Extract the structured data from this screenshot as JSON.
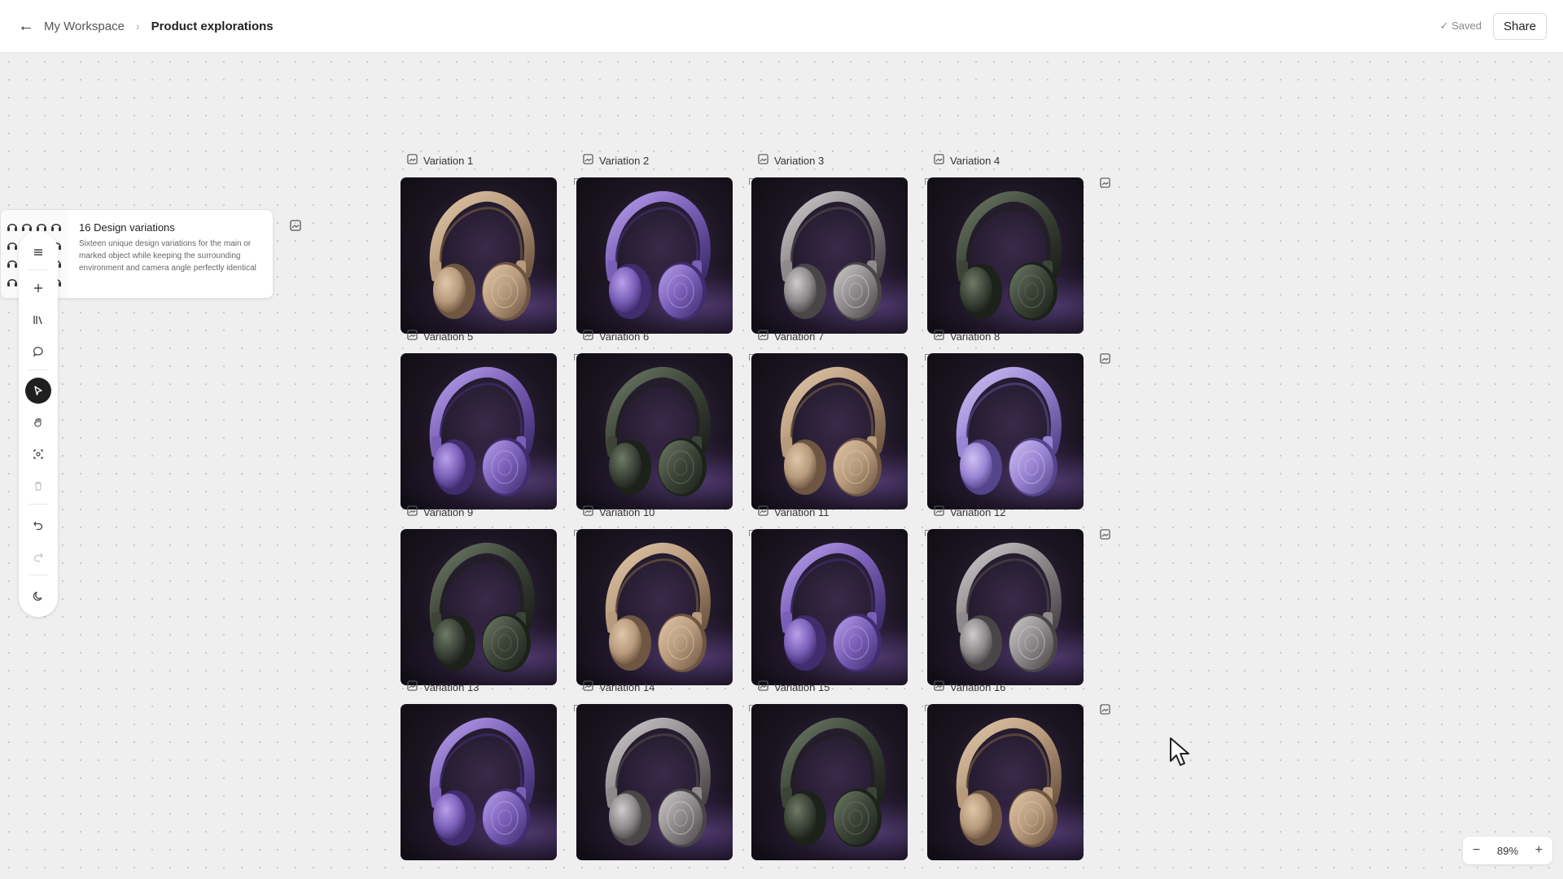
{
  "header": {
    "back_icon": "arrow-left-icon",
    "breadcrumb": {
      "workspace": "My Workspace",
      "separator": "›",
      "current": "Product explorations"
    },
    "saved_status": "✓ Saved",
    "share_label": "Share"
  },
  "info_card": {
    "title": "16 Design variations",
    "description": "Sixteen unique design variations for the main or marked object while keeping the surrounding environment and camera angle perfectly identical"
  },
  "toolbar": {
    "tools": [
      "menu-icon",
      "plus-icon",
      "library-icon",
      "comment-icon",
      "pointer-icon",
      "hand-icon",
      "focus-icon",
      "trash-icon",
      "undo-icon",
      "redo-icon",
      "theme-icon"
    ],
    "active_tool": "pointer-icon"
  },
  "variations": [
    {
      "label": "Variation 1",
      "color": "gold"
    },
    {
      "label": "Variation 2",
      "color": "purple"
    },
    {
      "label": "Variation 3",
      "color": "silver"
    },
    {
      "label": "Variation 4",
      "color": "green"
    },
    {
      "label": "Variation 5",
      "color": "purple"
    },
    {
      "label": "Variation 6",
      "color": "green"
    },
    {
      "label": "Variation 7",
      "color": "gold"
    },
    {
      "label": "Variation 8",
      "color": "lavender"
    },
    {
      "label": "Variation 9",
      "color": "green"
    },
    {
      "label": "Variation 10",
      "color": "gold"
    },
    {
      "label": "Variation 11",
      "color": "purple"
    },
    {
      "label": "Variation 12",
      "color": "silver"
    },
    {
      "label": "Variation 13",
      "color": "purple"
    },
    {
      "label": "Variation 14",
      "color": "silver"
    },
    {
      "label": "Variation 15",
      "color": "green"
    },
    {
      "label": "Variation 16",
      "color": "gold"
    }
  ],
  "palette": {
    "gold": {
      "main": "#b89a7c",
      "light": "#e0c6a8",
      "dark": "#6e5642"
    },
    "purple": {
      "main": "#7a5fb8",
      "light": "#b8a0ea",
      "dark": "#3f2d6e"
    },
    "lavender": {
      "main": "#9a84d4",
      "light": "#cfc0f2",
      "dark": "#54448a"
    },
    "silver": {
      "main": "#8e8a8c",
      "light": "#cfcbcd",
      "dark": "#4a4648"
    },
    "green": {
      "main": "#3c4438",
      "light": "#6e7a66",
      "dark": "#1c211a"
    }
  },
  "zoom": {
    "minus": "−",
    "value": "89%",
    "plus": "+"
  }
}
